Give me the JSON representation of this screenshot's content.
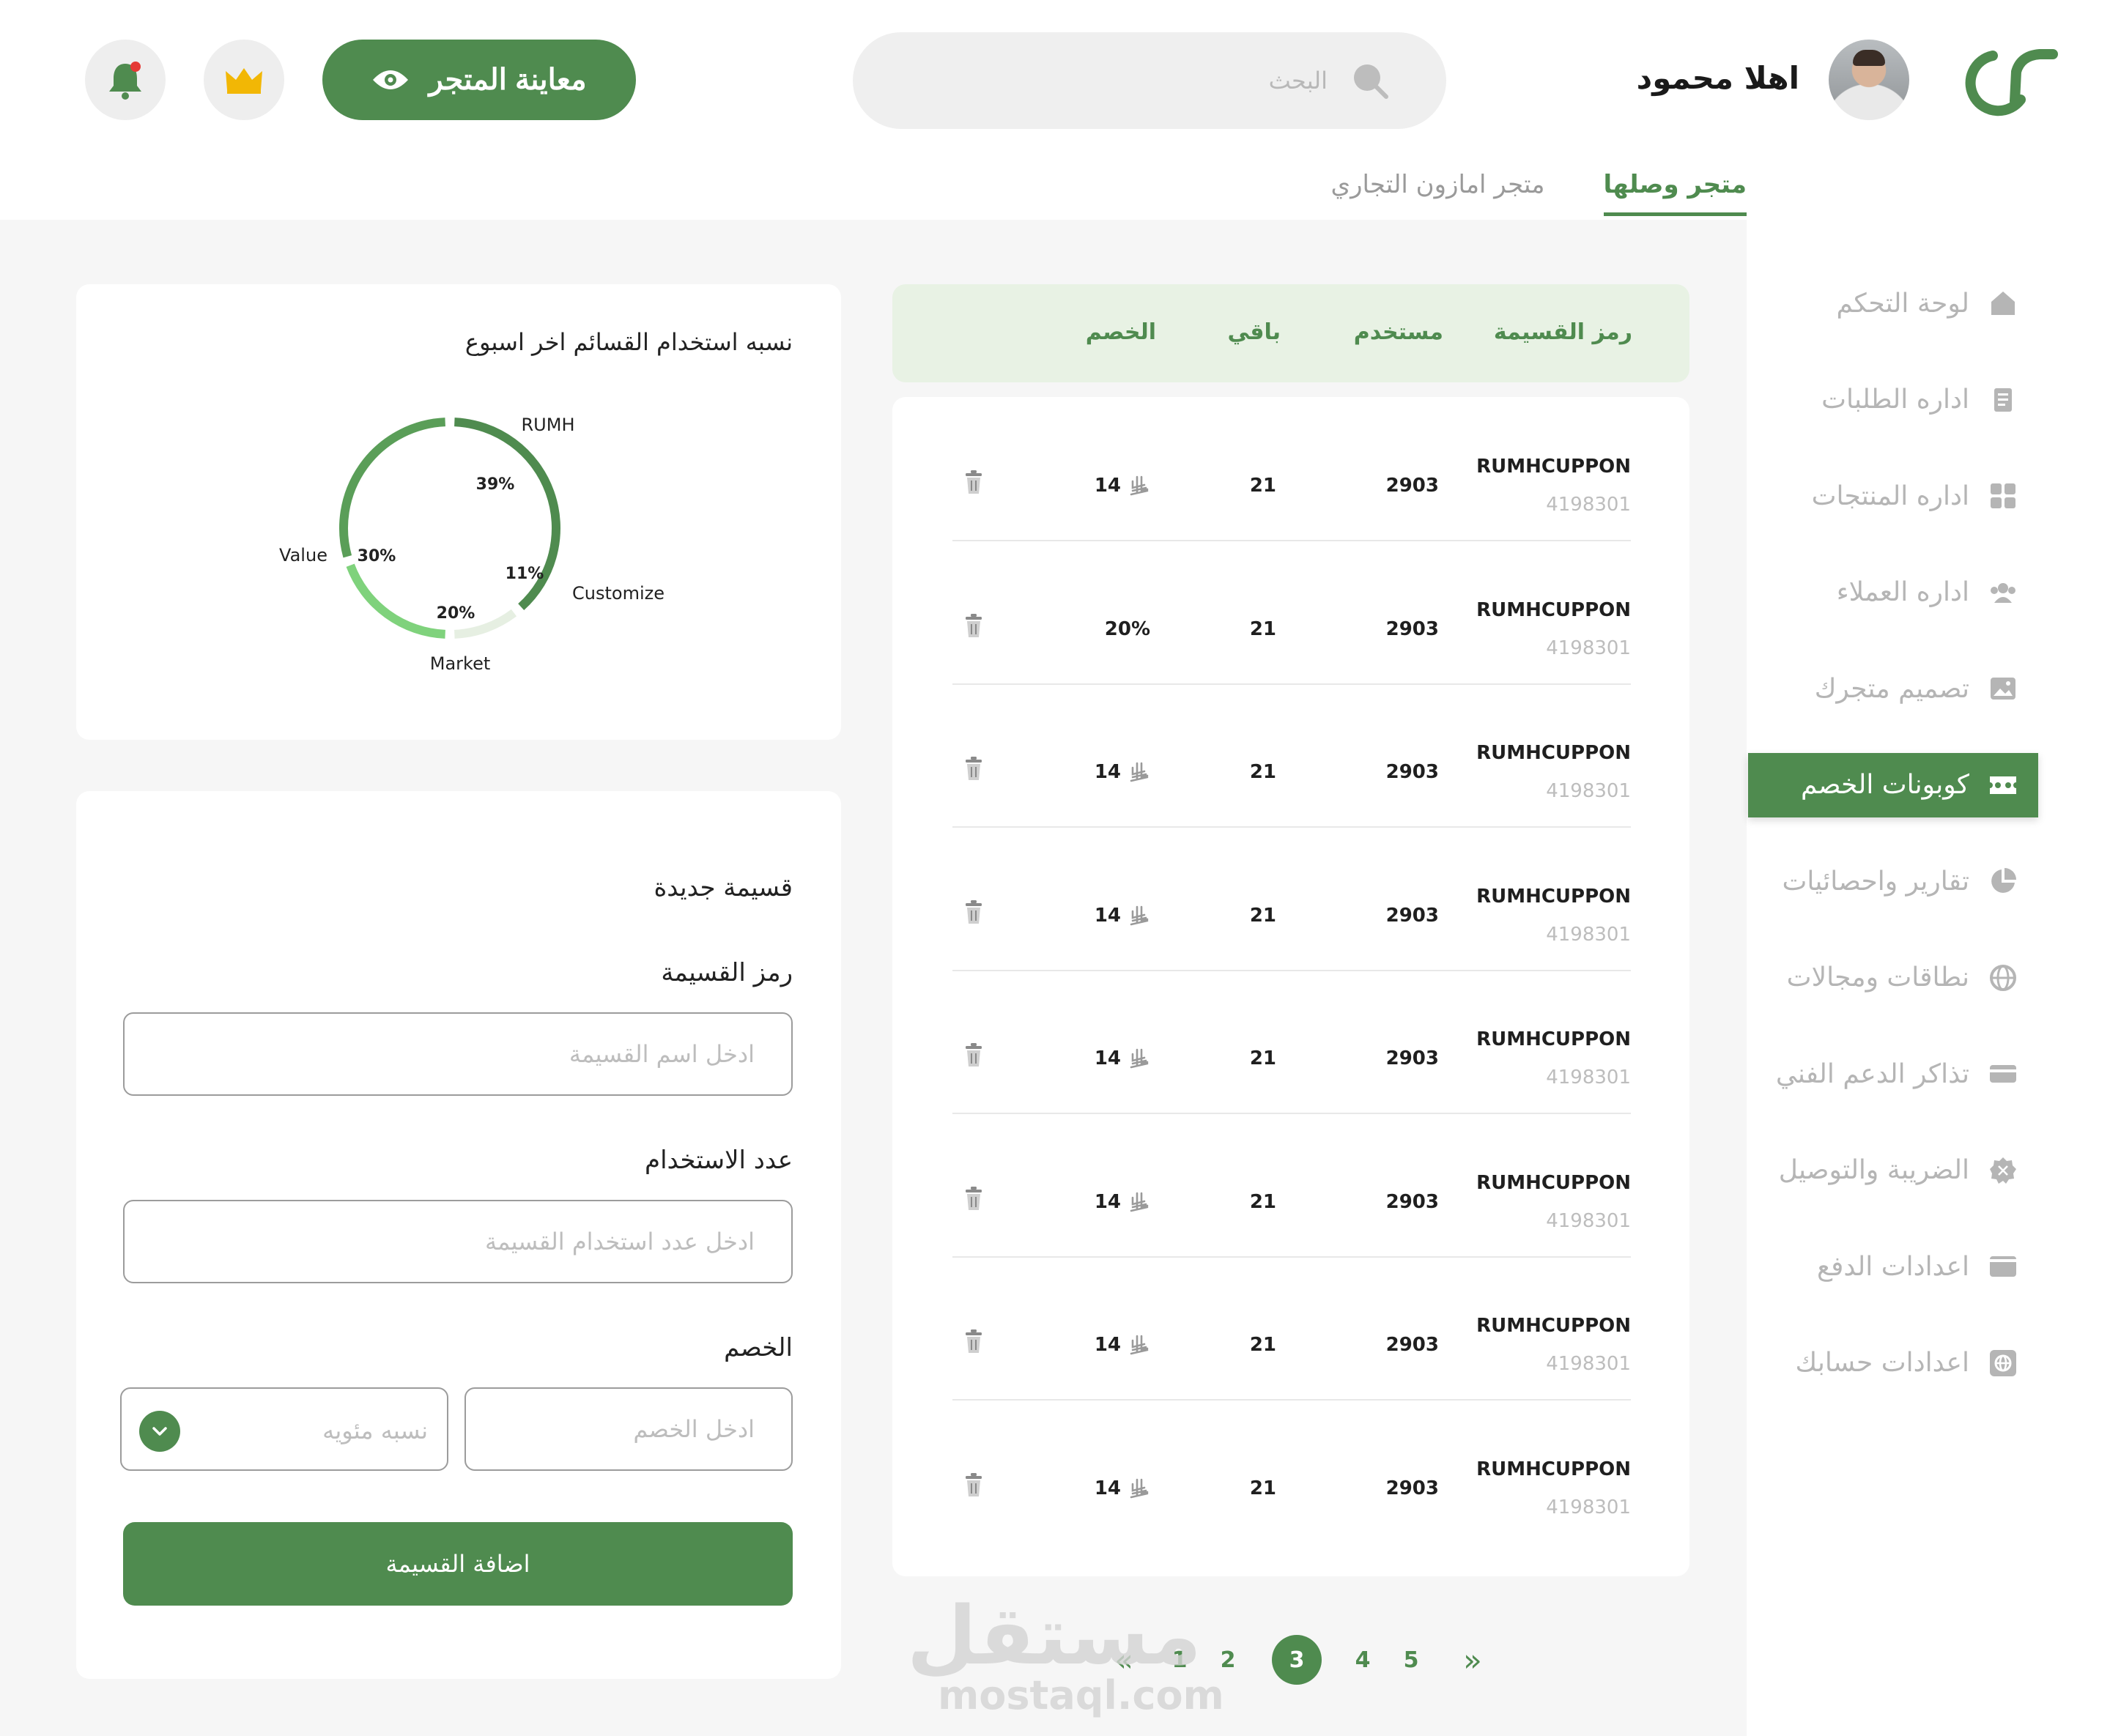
{
  "header": {
    "greeting": "اهلا محمود",
    "search_placeholder": "البحث",
    "preview_label": "معاينة المتجر"
  },
  "store_tabs": [
    {
      "label": "متجر وصلها",
      "active": true
    },
    {
      "label": "متجر امازون التجاري",
      "active": false
    }
  ],
  "sidebar": {
    "items": [
      {
        "label": "لوحة التحكم",
        "icon": "home-icon"
      },
      {
        "label": "اداره الطلبات",
        "icon": "orders-icon"
      },
      {
        "label": "اداره المنتجات",
        "icon": "grid-icon"
      },
      {
        "label": "اداره العملاء",
        "icon": "users-icon"
      },
      {
        "label": "تصميم متجرك",
        "icon": "image-icon"
      },
      {
        "label": "كوبونات الخصم",
        "icon": "ticket-icon",
        "active": true
      },
      {
        "label": "تقارير واحصائيات",
        "icon": "pie-chart-icon"
      },
      {
        "label": "نطاقات ومجالات",
        "icon": "globe-icon"
      },
      {
        "label": "تذاكر الدعم الفني",
        "icon": "card-icon"
      },
      {
        "label": "الضريبة والتوصيل",
        "icon": "badge-icon"
      },
      {
        "label": "اعدادات الدفع",
        "icon": "wallet-icon"
      },
      {
        "label": "اعدادات حسابك",
        "icon": "settings-globe-icon"
      }
    ]
  },
  "chart": {
    "title": "نسبه استخدام القسائم اخر اسبوع"
  },
  "chart_data": {
    "type": "pie",
    "title": "نسبه استخدام القسائم اخر اسبوع",
    "categories": [
      "RUMH",
      "Customize",
      "Market",
      "Value"
    ],
    "values": [
      39,
      11,
      20,
      30
    ],
    "value_labels": [
      "39%",
      "11%",
      "20%",
      "30%"
    ],
    "colors": [
      "#4f8b4f",
      "#e6efe2",
      "#7fd27c",
      "#5a9e58"
    ],
    "donut": true
  },
  "form": {
    "title": "قسيمة جديدة",
    "code_label": "رمز القسيمة",
    "code_placeholder": "ادخل اسم القسيمة",
    "usage_label": "عدد الاستخدام",
    "usage_placeholder": "ادخل عدد استخدام القسيمة",
    "discount_label": "الخصم",
    "discount_placeholder": "ادخل الخصم",
    "discount_type_value": "نسبه مئويه",
    "submit_label": "اضافة القسيمة"
  },
  "table": {
    "headers": {
      "code": "رمز القسيمة",
      "used": "مستخدم",
      "remaining": "باقي",
      "discount": "الخصم"
    },
    "currency": "⃁",
    "rows": [
      {
        "code": "RUMHCUPPON",
        "sub": "4198301",
        "used": "2903",
        "remaining": "21",
        "discount": "14",
        "currency": true
      },
      {
        "code": "RUMHCUPPON",
        "sub": "4198301",
        "used": "2903",
        "remaining": "21",
        "discount": "20%",
        "currency": false
      },
      {
        "code": "RUMHCUPPON",
        "sub": "4198301",
        "used": "2903",
        "remaining": "21",
        "discount": "14",
        "currency": true
      },
      {
        "code": "RUMHCUPPON",
        "sub": "4198301",
        "used": "2903",
        "remaining": "21",
        "discount": "14",
        "currency": true
      },
      {
        "code": "RUMHCUPPON",
        "sub": "4198301",
        "used": "2903",
        "remaining": "21",
        "discount": "14",
        "currency": true
      },
      {
        "code": "RUMHCUPPON",
        "sub": "4198301",
        "used": "2903",
        "remaining": "21",
        "discount": "14",
        "currency": true
      },
      {
        "code": "RUMHCUPPON",
        "sub": "4198301",
        "used": "2903",
        "remaining": "21",
        "discount": "14",
        "currency": true
      },
      {
        "code": "RUMHCUPPON",
        "sub": "4198301",
        "used": "2903",
        "remaining": "21",
        "discount": "14",
        "currency": true
      }
    ]
  },
  "pagination": {
    "pages": [
      "1",
      "2",
      "3",
      "4",
      "5"
    ],
    "current": "3",
    "prev": "«",
    "next": "»"
  },
  "watermark": {
    "ar": "مستقل",
    "en": "mostaql.com"
  },
  "colors": {
    "accent": "#4f8b4f",
    "header_row": "#e8f2e4",
    "notification": "#e53935",
    "crown": "#f2b705"
  }
}
